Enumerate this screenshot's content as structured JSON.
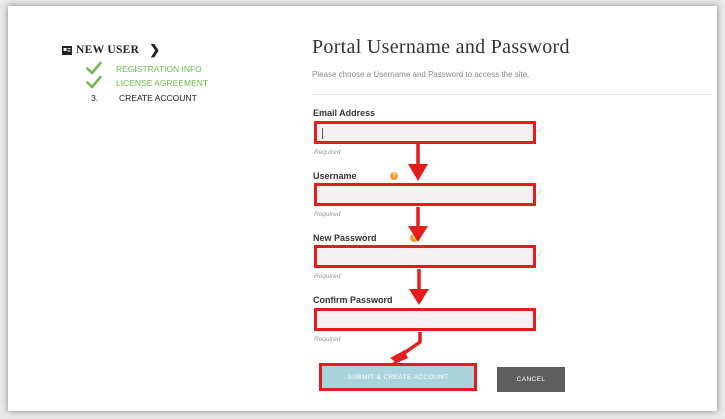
{
  "sidebar": {
    "section_icon": "id-card-icon",
    "title": "NEW USER",
    "chevron": "❯",
    "steps": [
      {
        "label": "REGISTRATION INFO",
        "status": "done",
        "icon": "check-icon"
      },
      {
        "label": "LICENSE AGREEMENT",
        "status": "done",
        "icon": "check-icon"
      },
      {
        "number": "3.",
        "label": "CREATE ACCOUNT",
        "status": "current"
      }
    ]
  },
  "main": {
    "title": "Portal Username and Password",
    "subtitle": "Please choose a Username and Password to access the site.",
    "fields": [
      {
        "label": "Email Address",
        "value": "",
        "required_text": "Required"
      },
      {
        "label": "Username",
        "value": "",
        "required_text": "Required",
        "help_icon": "help-icon"
      },
      {
        "label": "New Password",
        "value": "",
        "required_text": "Required",
        "help_icon": "help-icon"
      },
      {
        "label": "Confirm Password",
        "value": "",
        "required_text": "Required"
      }
    ],
    "submit_label": "SUBMIT & CREATE ACCOUNT",
    "cancel_label": "CANCEL",
    "help_glyph": "?"
  },
  "colors": {
    "highlight_red": "#e51c1c",
    "step_done_green": "#6dbb4a",
    "submit_bg": "#a9d4dc",
    "cancel_bg": "#5e5e5e",
    "input_bg": "#f4f0f1"
  }
}
